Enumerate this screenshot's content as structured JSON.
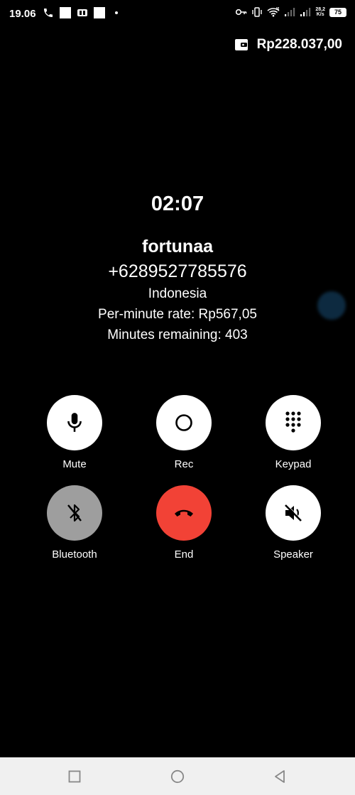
{
  "status_bar": {
    "time": "19.06",
    "network_speed_value": "28,2",
    "network_speed_unit": "K/s",
    "battery_level": "75",
    "signal_r1": "R",
    "signal_r2": "R"
  },
  "wallet": {
    "icon": "wallet-icon",
    "balance": "Rp228.037,00"
  },
  "call": {
    "duration": "02:07",
    "contact_name": "fortunaa",
    "phone_number": "+6289527785576",
    "country": "Indonesia",
    "rate": "Per-minute rate: Rp567,05",
    "minutes_remaining": "Minutes remaining: 403"
  },
  "controls": {
    "mute": "Mute",
    "rec": "Rec",
    "keypad": "Keypad",
    "bluetooth": "Bluetooth",
    "end": "End",
    "speaker": "Speaker"
  },
  "colors": {
    "background": "#000000",
    "end_call": "#f24236",
    "disabled_button": "#9e9e9e",
    "nav_bar": "#f0f0f0"
  }
}
